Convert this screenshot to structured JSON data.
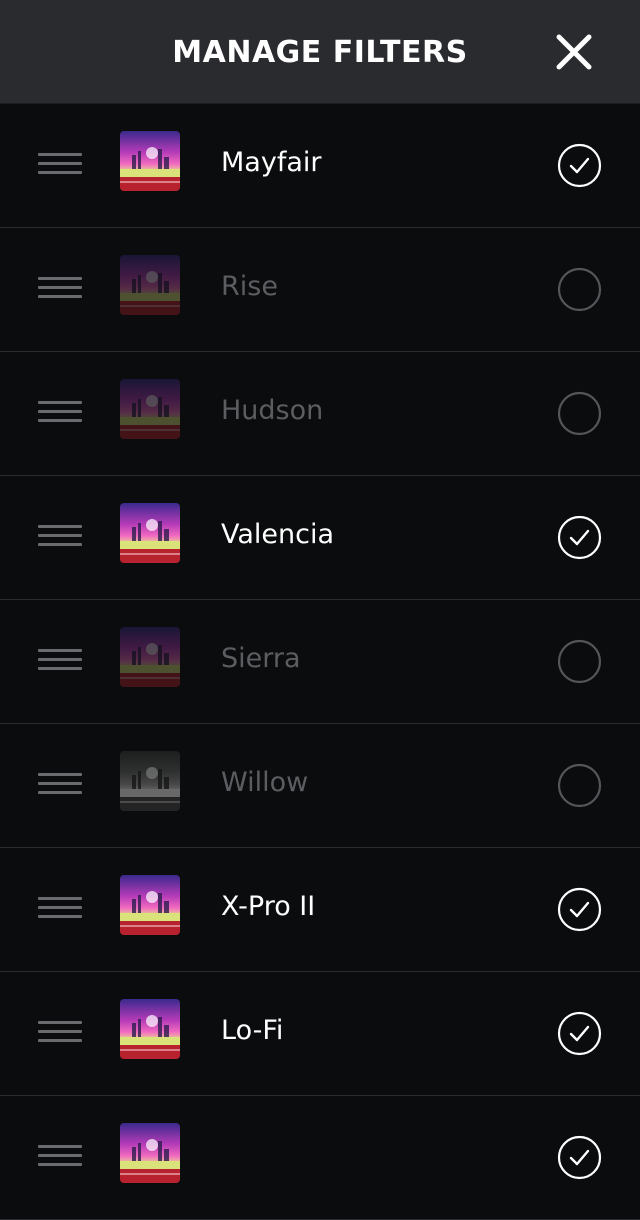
{
  "header": {
    "title": "MANAGE FILTERS",
    "close_icon": "close-icon"
  },
  "filters": [
    {
      "name": "Mayfair",
      "enabled": true
    },
    {
      "name": "Rise",
      "enabled": false
    },
    {
      "name": "Hudson",
      "enabled": false
    },
    {
      "name": "Valencia",
      "enabled": true
    },
    {
      "name": "Sierra",
      "enabled": false
    },
    {
      "name": "Willow",
      "enabled": false
    },
    {
      "name": "X-Pro II",
      "enabled": true
    },
    {
      "name": "Lo-Fi",
      "enabled": true
    },
    {
      "name": "",
      "enabled": true
    }
  ],
  "colors": {
    "background": "#0b0c0d",
    "header_background": "#2a2b2e",
    "enabled_text": "#ffffff",
    "disabled_text": "#5c5d60"
  }
}
